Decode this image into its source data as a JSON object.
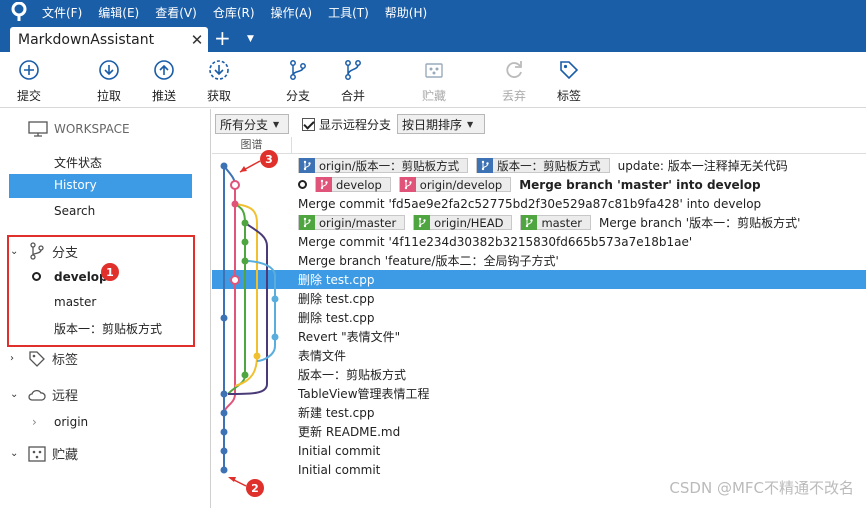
{
  "menu": [
    "文件(F)",
    "编辑(E)",
    "查看(V)",
    "仓库(R)",
    "操作(A)",
    "工具(T)",
    "帮助(H)"
  ],
  "tab": {
    "title": "MarkdownAssistant",
    "close": "✕",
    "add": "+",
    "dropdown": "▼"
  },
  "toolbar": {
    "commit": "提交",
    "pull": "拉取",
    "push": "推送",
    "fetch": "获取",
    "branch": "分支",
    "merge": "合并",
    "stash": "贮藏",
    "discard": "丢弃",
    "tag": "标签"
  },
  "sidebar": {
    "workspace": "WORKSPACE",
    "file_status": "文件状态",
    "history": "History",
    "search": "Search",
    "branches_header": "分支",
    "branches": [
      "develop",
      "master",
      "版本一：剪贴板方式"
    ],
    "tags_header": "标签",
    "remotes_header": "远程",
    "remote_origin": "origin",
    "stash_header": "贮藏",
    "chevron_down": "⌄",
    "chevron_right": "›"
  },
  "badges": {
    "one": "1",
    "two": "2",
    "three": "3"
  },
  "filters": {
    "all_branches": "所有分支",
    "show_remote": "显示远程分支",
    "sort_by_date": "按日期排序"
  },
  "columns": {
    "graph": "图谱"
  },
  "commits": {
    "r0": {
      "refs": [
        "origin/版本一：剪贴板方式",
        "版本一：剪贴板方式"
      ],
      "message": "update: 版本一注释掉无关代码"
    },
    "r1": {
      "refs": [
        "develop",
        "origin/develop"
      ],
      "message": "Merge branch 'master' into develop"
    },
    "r2": {
      "refs": [
        "origin/master",
        "origin/HEAD",
        "master"
      ],
      "message": "Merge branch '版本一：剪贴板方式'"
    },
    "r3": {
      "message": "Merge commit 'fd5ae9e2fa2c52775bd2f30e529a87c81b9fa428' into develop"
    },
    "r4": {
      "message": "Merge commit '4f11e234d30382b3215830fd665b573a7e18b1ae'"
    },
    "r5": {
      "message": "Merge branch 'feature/版本二：全局钩子方式'"
    },
    "r6": {
      "message": "删除 test.cpp"
    },
    "r7": {
      "message": "删除 test.cpp"
    },
    "r8": {
      "message": "删除 test.cpp"
    },
    "r9": {
      "message": "Revert \"表情文件\""
    },
    "r10": {
      "message": "表情文件"
    },
    "r11": {
      "message": "版本一：剪贴板方式"
    },
    "r12": {
      "message": "TableView管理表情工程"
    },
    "r13": {
      "message": "新建 test.cpp"
    },
    "r14": {
      "message": "更新 README.md"
    },
    "r15": {
      "message": "Initial commit"
    },
    "r16": {
      "message": "Initial commit"
    }
  },
  "colors": {
    "accent": "#1b5ea8",
    "selection": "#3c9be4",
    "annotation_red": "#e0302b",
    "lane_blue": "#3d72b4",
    "lane_pink": "#e0547a",
    "lane_green": "#4fa640",
    "lane_yellow": "#f0c030",
    "lane_purple": "#4a3a78",
    "lane_lightblue": "#5aaede"
  },
  "watermark": "CSDN @MFC不精通不改名"
}
